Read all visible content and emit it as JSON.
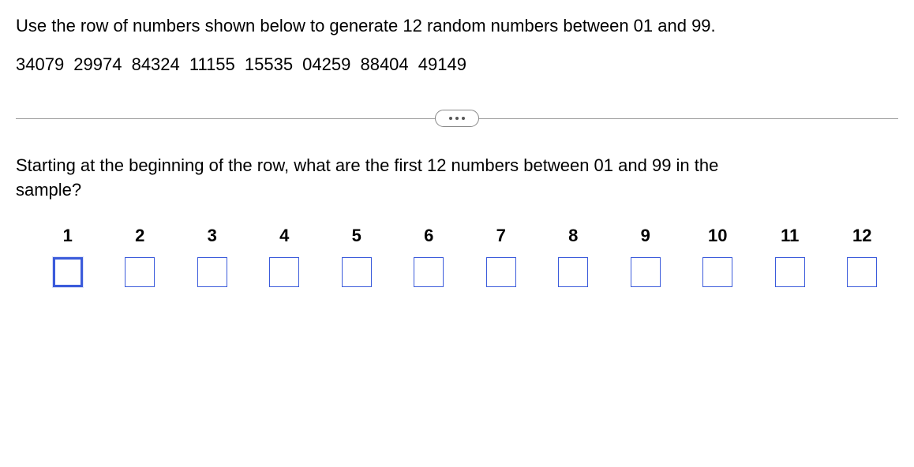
{
  "instruction": "Use the row of numbers shown below to generate 12 random numbers between 01 and 99.",
  "number_row": "34079  29974  84324  11155  15535  04259  88404  49149",
  "question": "Starting at the beginning of the row, what are the first 12 numbers between 01 and 99 in the sample?",
  "columns": [
    {
      "label": "1",
      "value": ""
    },
    {
      "label": "2",
      "value": ""
    },
    {
      "label": "3",
      "value": ""
    },
    {
      "label": "4",
      "value": ""
    },
    {
      "label": "5",
      "value": ""
    },
    {
      "label": "6",
      "value": ""
    },
    {
      "label": "7",
      "value": ""
    },
    {
      "label": "8",
      "value": ""
    },
    {
      "label": "9",
      "value": ""
    },
    {
      "label": "10",
      "value": ""
    },
    {
      "label": "11",
      "value": ""
    },
    {
      "label": "12",
      "value": ""
    }
  ],
  "active_input_index": 0
}
